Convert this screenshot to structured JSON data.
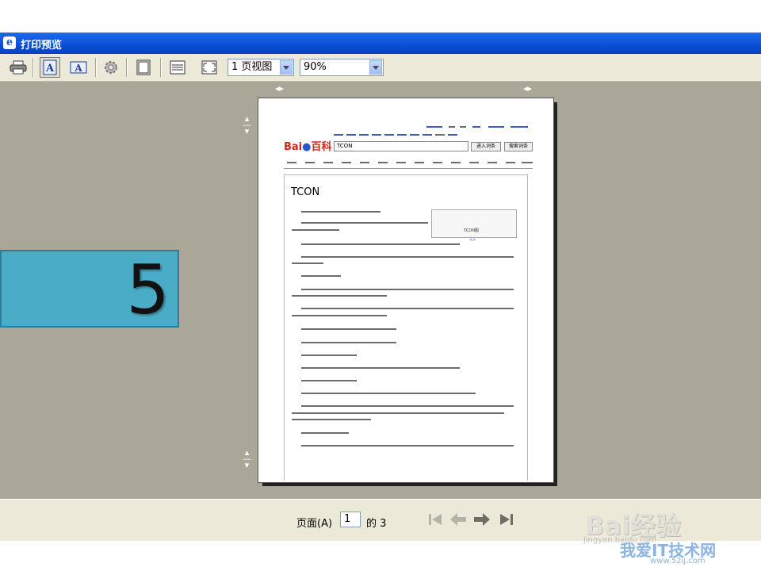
{
  "window": {
    "title": "打印预览",
    "app_icon": "ie-icon"
  },
  "toolbar": {
    "view_mode": "1 页视图",
    "zoom": "90%",
    "buttons": [
      "print-icon",
      "portrait-icon",
      "landscape-icon",
      "page-setup-icon",
      "header-footer-icon",
      "full-width-icon",
      "full-page-icon"
    ]
  },
  "page_content": {
    "top_links": [
      "登录",
      "注册",
      "设置",
      "百科首页",
      "百度首页"
    ],
    "nav_links": [
      "新闻",
      "网页",
      "贴吧",
      "知道",
      "音乐",
      "图片",
      "视频",
      "地图",
      "百科",
      "文库"
    ],
    "logo_text": "百科",
    "search_value": "TCON",
    "search_button": "进入词条",
    "search_button2": "搜索词条",
    "tabs": [
      "首页",
      "分类",
      "文化",
      "地理",
      "生活",
      "科技",
      "社会",
      "历史",
      "人物",
      "体育",
      "艺术",
      "经济",
      "自然",
      "手机百科"
    ],
    "heading": "TCON",
    "image_caption": "TCON图"
  },
  "overlay": {
    "step_number": "5",
    "color": "#4aacc7"
  },
  "statusbar": {
    "page_label": "页面(A)",
    "current_page": "1",
    "of_label": "的 3"
  },
  "watermark": {
    "text": "Bai经验",
    "sub": "jingyan.baidu.com",
    "brand": "我爱IT技术网",
    "url": "www.52ij.com"
  }
}
